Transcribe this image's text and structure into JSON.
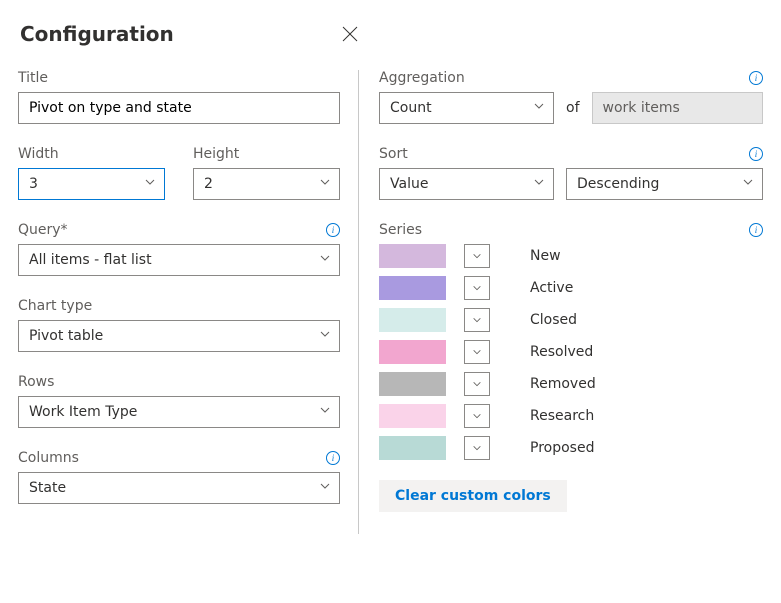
{
  "heading": "Configuration",
  "left": {
    "title_label": "Title",
    "title_value": "Pivot on type and state",
    "width_label": "Width",
    "width_value": "3",
    "height_label": "Height",
    "height_value": "2",
    "query_label": "Query*",
    "query_value": "All items - flat list",
    "chart_type_label": "Chart type",
    "chart_type_value": "Pivot table",
    "rows_label": "Rows",
    "rows_value": "Work Item Type",
    "columns_label": "Columns",
    "columns_value": "State"
  },
  "right": {
    "aggregation_label": "Aggregation",
    "aggregation_value": "Count",
    "of_text": "of",
    "work_items_text": "work items",
    "sort_label": "Sort",
    "sort_field": "Value",
    "sort_dir": "Descending",
    "series_label": "Series",
    "series": [
      {
        "label": "New",
        "color": "#d4b8dd"
      },
      {
        "label": "Active",
        "color": "#a99ae0"
      },
      {
        "label": "Closed",
        "color": "#d5ecea"
      },
      {
        "label": "Resolved",
        "color": "#f2a6cf"
      },
      {
        "label": "Removed",
        "color": "#b7b7b7"
      },
      {
        "label": "Research",
        "color": "#fad3e9"
      },
      {
        "label": "Proposed",
        "color": "#b8dad6"
      }
    ],
    "clear_colors": "Clear custom colors"
  }
}
